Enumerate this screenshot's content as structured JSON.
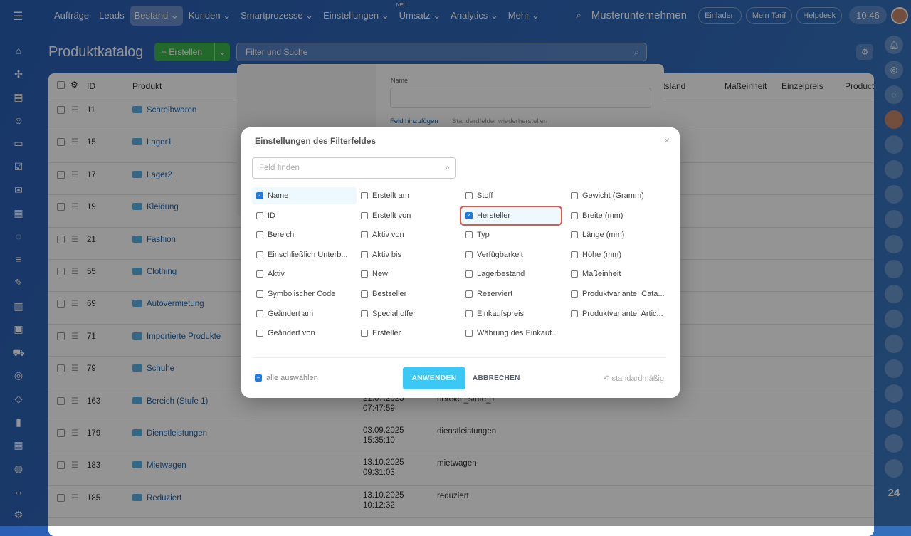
{
  "topnav": {
    "items": [
      "Aufträge",
      "Leads",
      "Bestand",
      "Kunden",
      "Smartprozesse",
      "Einstellungen",
      "Umsatz",
      "Analytics",
      "Mehr"
    ],
    "active": "Bestand",
    "new_badge": "NEU",
    "company": "Musterunternehmen",
    "invite": "Einladen",
    "tariff": "Mein Tarif",
    "helpdesk": "Helpdesk",
    "time": "10:46"
  },
  "page": {
    "title": "Produktkatalog",
    "create": "+ Erstellen",
    "search_placeholder": "Filter und Suche"
  },
  "table": {
    "headers": {
      "id": "ID",
      "product": "Produkt",
      "origin": "ftsland",
      "unit": "Maßeinheit",
      "price": "Einzelpreis",
      "product2": "Product"
    },
    "rows": [
      {
        "id": "11",
        "name": "Schreibwaren"
      },
      {
        "id": "15",
        "name": "Lager1"
      },
      {
        "id": "17",
        "name": "Lager2"
      },
      {
        "id": "19",
        "name": "Kleidung"
      },
      {
        "id": "21",
        "name": "Fashion"
      },
      {
        "id": "55",
        "name": "Clothing"
      },
      {
        "id": "69",
        "name": "Autovermietung"
      },
      {
        "id": "71",
        "name": "Importierte Produkte"
      },
      {
        "id": "79",
        "name": "Schuhe"
      },
      {
        "id": "163",
        "name": "Bereich (Stufe 1)",
        "date": "21.07.2025",
        "time": "07:47:59",
        "code": "bereich_stufe_1"
      },
      {
        "id": "179",
        "name": "Dienstleistungen",
        "date": "03.09.2025",
        "time": "15:35:10",
        "code": "dienstleistungen"
      },
      {
        "id": "183",
        "name": "Mietwagen",
        "date": "13.10.2025",
        "time": "09:31:03",
        "code": "mietwagen"
      },
      {
        "id": "185",
        "name": "Reduziert",
        "date": "13.10.2025",
        "time": "10:12:32",
        "code": "reduziert"
      }
    ]
  },
  "filter_popup": {
    "field_label": "Name",
    "add_field": "Feld hinzufügen",
    "restore": "Standardfelder wiederherstellen"
  },
  "modal": {
    "title": "Einstellungen des Filterfeldes",
    "search_placeholder": "Feld finden",
    "select_all": "alle auswählen",
    "apply": "ANWENDEN",
    "cancel": "ABBRECHEN",
    "reset": "standardmäßig",
    "fields": [
      {
        "label": "Name",
        "checked": true
      },
      {
        "label": "Erstellt am",
        "checked": false
      },
      {
        "label": "Stoff",
        "checked": false
      },
      {
        "label": "Gewicht (Gramm)",
        "checked": false
      },
      {
        "label": "ID",
        "checked": false
      },
      {
        "label": "Erstellt von",
        "checked": false
      },
      {
        "label": "Hersteller",
        "checked": true,
        "highlight": true
      },
      {
        "label": "Breite (mm)",
        "checked": false
      },
      {
        "label": "Bereich",
        "checked": false
      },
      {
        "label": "Aktiv von",
        "checked": false
      },
      {
        "label": "Typ",
        "checked": false
      },
      {
        "label": "Länge (mm)",
        "checked": false
      },
      {
        "label": "Einschließlich Unterb...",
        "checked": false
      },
      {
        "label": "Aktiv bis",
        "checked": false
      },
      {
        "label": "Verfügbarkeit",
        "checked": false
      },
      {
        "label": "Höhe (mm)",
        "checked": false
      },
      {
        "label": "Aktiv",
        "checked": false
      },
      {
        "label": "New",
        "checked": false
      },
      {
        "label": "Lagerbestand",
        "checked": false
      },
      {
        "label": "Maßeinheit",
        "checked": false
      },
      {
        "label": "Symbolischer Code",
        "checked": false
      },
      {
        "label": "Bestseller",
        "checked": false
      },
      {
        "label": "Reserviert",
        "checked": false
      },
      {
        "label": "Produktvariante: Cata...",
        "checked": false
      },
      {
        "label": "Geändert am",
        "checked": false
      },
      {
        "label": "Special offer",
        "checked": false
      },
      {
        "label": "Einkaufspreis",
        "checked": false
      },
      {
        "label": "Produktvariante: Artic...",
        "checked": false
      },
      {
        "label": "Geändert von",
        "checked": false
      },
      {
        "label": "Ersteller",
        "checked": false
      },
      {
        "label": "Währung des Einkauf...",
        "checked": false
      }
    ]
  },
  "rightbar_badge": "24"
}
